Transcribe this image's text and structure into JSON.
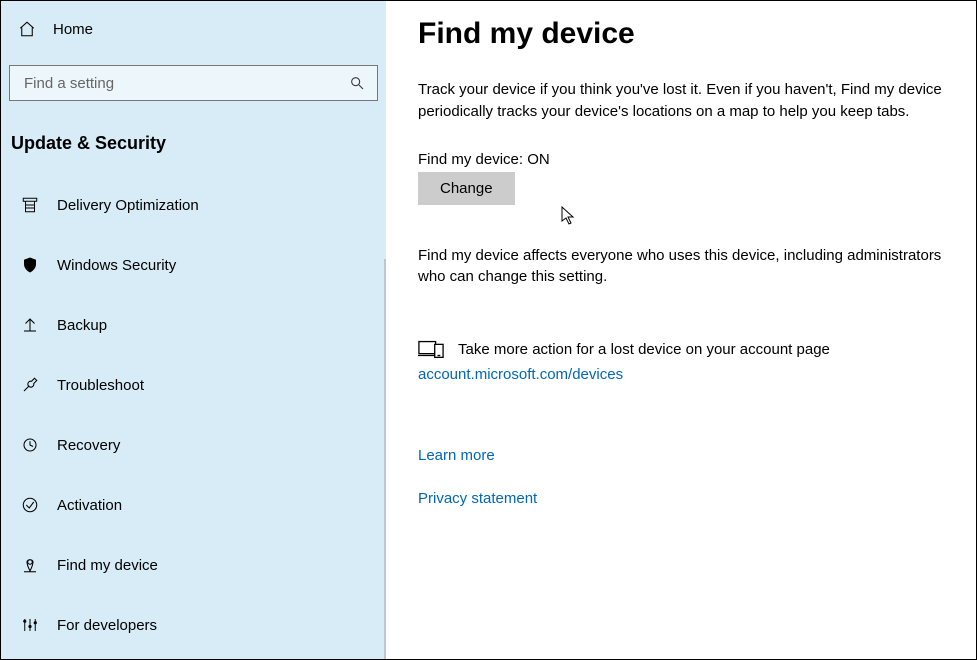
{
  "sidebar": {
    "home_label": "Home",
    "search_placeholder": "Find a setting",
    "section_header": "Update & Security",
    "items": [
      {
        "label": "Delivery Optimization"
      },
      {
        "label": "Windows Security"
      },
      {
        "label": "Backup"
      },
      {
        "label": "Troubleshoot"
      },
      {
        "label": "Recovery"
      },
      {
        "label": "Activation"
      },
      {
        "label": "Find my device"
      },
      {
        "label": "For developers"
      }
    ]
  },
  "main": {
    "title": "Find my device",
    "description": "Track your device if you think you've lost it. Even if you haven't, Find my device periodically tracks your device's locations on a map to help you keep tabs.",
    "status_label": "Find my device: ",
    "status_value": "ON",
    "change_button": "Change",
    "subtext": "Find my device affects everyone who uses this device, including administrators who can change this setting.",
    "action_text": "Take more action for a lost device on your account page",
    "account_link": "account.microsoft.com/devices",
    "learn_more": "Learn more",
    "privacy": "Privacy statement"
  }
}
